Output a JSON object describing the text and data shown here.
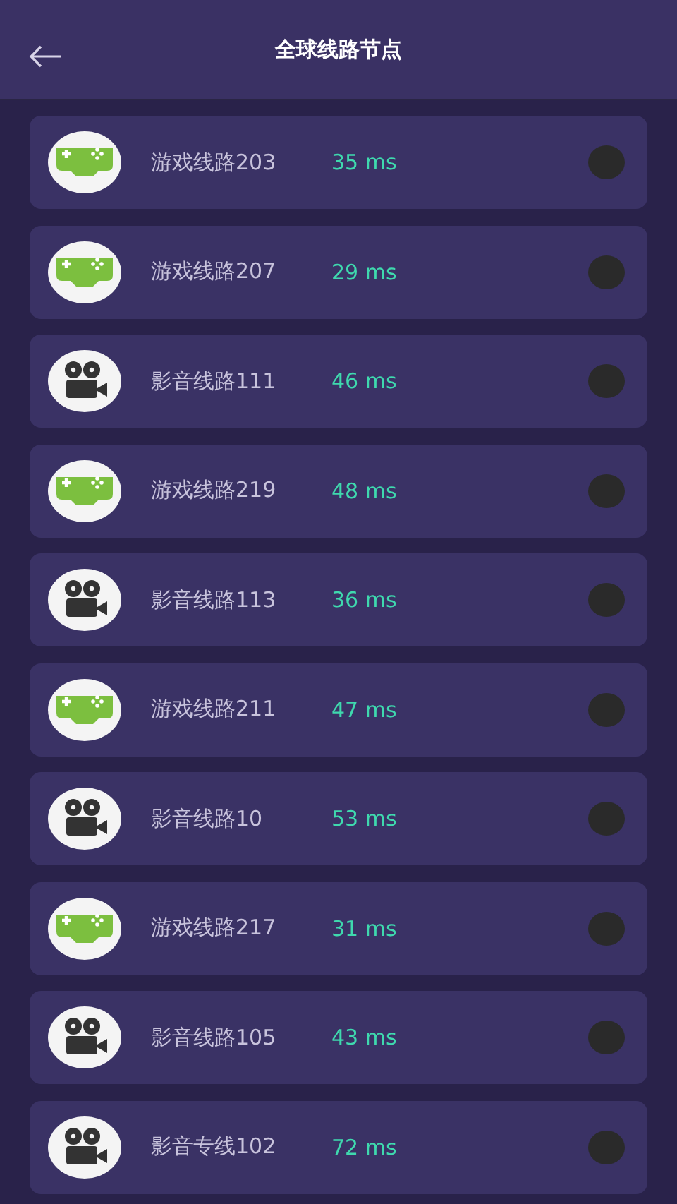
{
  "header": {
    "title": "全球线路节点"
  },
  "nodes": [
    {
      "kind": "game",
      "name": "游戏线路203",
      "latency": "35 ms",
      "selected": false
    },
    {
      "kind": "game",
      "name": "游戏线路207",
      "latency": "29 ms",
      "selected": false
    },
    {
      "kind": "video",
      "name": "影音线路111",
      "latency": "46 ms",
      "selected": false
    },
    {
      "kind": "game",
      "name": "游戏线路219",
      "latency": "48 ms",
      "selected": false
    },
    {
      "kind": "video",
      "name": "影音线路113",
      "latency": "36 ms",
      "selected": false
    },
    {
      "kind": "game",
      "name": "游戏线路211",
      "latency": "47 ms",
      "selected": false
    },
    {
      "kind": "video",
      "name": "影音线路10",
      "latency": "53 ms",
      "selected": false
    },
    {
      "kind": "game",
      "name": "游戏线路217",
      "latency": "31 ms",
      "selected": false
    },
    {
      "kind": "video",
      "name": "影音线路105",
      "latency": "43 ms",
      "selected": false
    },
    {
      "kind": "video",
      "name": "影音专线102",
      "latency": "72 ms",
      "selected": false
    }
  ]
}
